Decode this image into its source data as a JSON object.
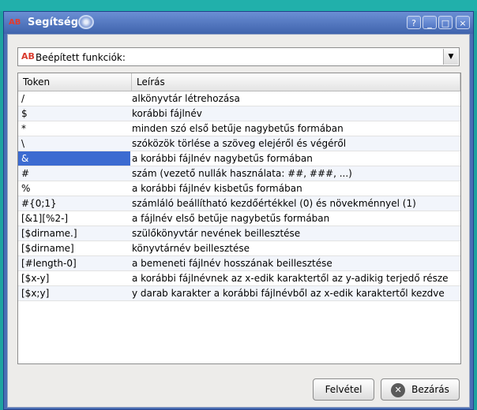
{
  "window": {
    "title": "Segítség",
    "app_icon": "AB",
    "buttons": {
      "help": "?",
      "minimize": "_",
      "maximize": "□",
      "close": "×"
    }
  },
  "combo": {
    "icon": "AB",
    "selected": "Beépített funkciók:"
  },
  "table": {
    "columns": [
      "Token",
      "Leírás"
    ],
    "rows": [
      [
        "/",
        "alkönyvtár létrehozása"
      ],
      [
        "$",
        "korábbi fájlnév"
      ],
      [
        "*",
        "minden szó első betűje nagybetűs formában"
      ],
      [
        "\\",
        "szóközök törlése a szöveg elejéről és végéről"
      ],
      [
        "&",
        "a korábbi fájlnév nagybetűs formában"
      ],
      [
        "#",
        "szám (vezető nullák használata: ##, ###, ...)"
      ],
      [
        "%",
        "a korábbi fájlnév kisbetűs formában"
      ],
      [
        "#{0;1}",
        "számláló beállítható kezdőértékkel (0) és növekménnyel (1)"
      ],
      [
        "[&1][%2-]",
        "a fájlnév első betűje nagybetűs formában"
      ],
      [
        "[$dirname.]",
        "szülőkönyvtár nevének beillesztése"
      ],
      [
        "[$dirname]",
        "könyvtárnév beillesztése"
      ],
      [
        "[#length-0]",
        "a bemeneti fájlnév hosszának beillesztése"
      ],
      [
        "[$x-y]",
        "a korábbi fájlnévnek az x-edik karaktertől az y-adikig terjedő része"
      ],
      [
        "[$x;y]",
        "y darab karakter a korábbi fájlnévből az x-edik karaktertől kezdve"
      ]
    ],
    "selected_row": 4
  },
  "footer": {
    "record_label": "Felvétel",
    "close_label": "Bezárás"
  }
}
